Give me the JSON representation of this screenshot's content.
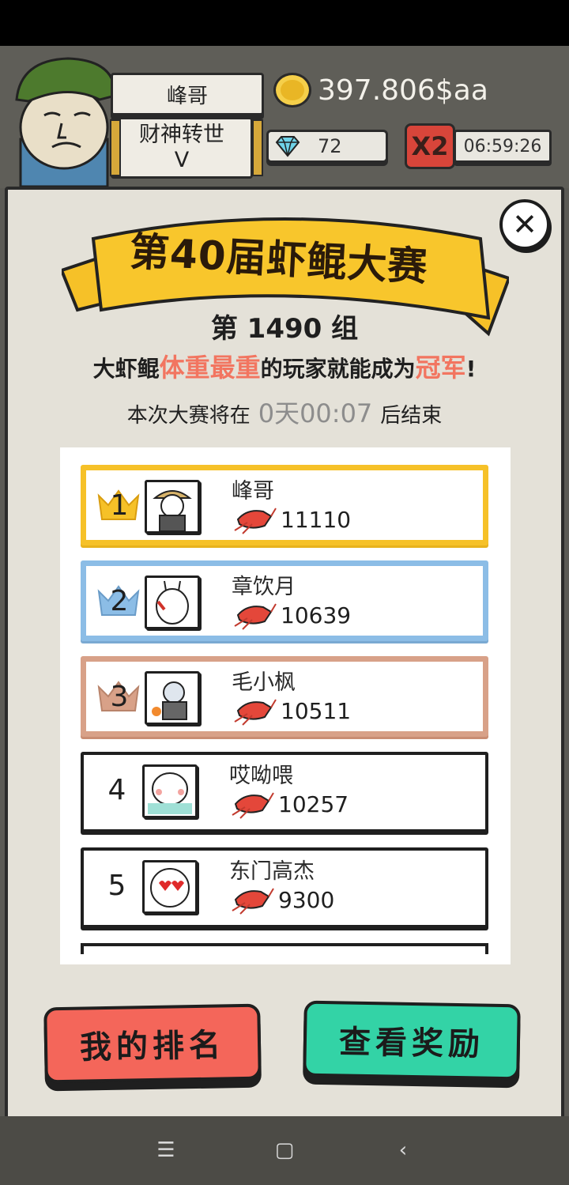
{
  "hud": {
    "player_name": "峰哥",
    "player_title": "财神转世",
    "player_rank": "V",
    "coins": "397.806$aa",
    "gems": "72",
    "multiplier": "X2",
    "timer": "06:59:26"
  },
  "event": {
    "title": "第40届虾鲲大赛",
    "group": "第 1490 组",
    "rule_prefix": "大虾鲲",
    "rule_highlight": "体重最重",
    "rule_middle": "的玩家就能成为",
    "rule_highlight2": "冠军",
    "rule_suffix": "!",
    "ends_prefix": "本次大赛将在",
    "ends_time": "0天00:07",
    "ends_suffix": "后结束"
  },
  "rankings": [
    {
      "rank": "1",
      "name": "峰哥",
      "weight": "11110"
    },
    {
      "rank": "2",
      "name": "章饮月",
      "weight": "10639"
    },
    {
      "rank": "3",
      "name": "毛小枫",
      "weight": "10511"
    },
    {
      "rank": "4",
      "name": "哎呦喂",
      "weight": "10257"
    },
    {
      "rank": "5",
      "name": "东门高杰",
      "weight": "9300"
    }
  ],
  "buttons": {
    "my_rank": "我的排名",
    "view_rewards": "查看奖励",
    "close": "✕"
  },
  "nav": {
    "menu": "☰",
    "home": "▢",
    "back": "‹"
  },
  "colors": {
    "gold": "#f6c128",
    "silver": "#8cbde6",
    "bronze": "#d8a188",
    "highlight": "#f27560",
    "my_rank_button": "#f4665a",
    "rewards_button": "#33d3a6"
  }
}
